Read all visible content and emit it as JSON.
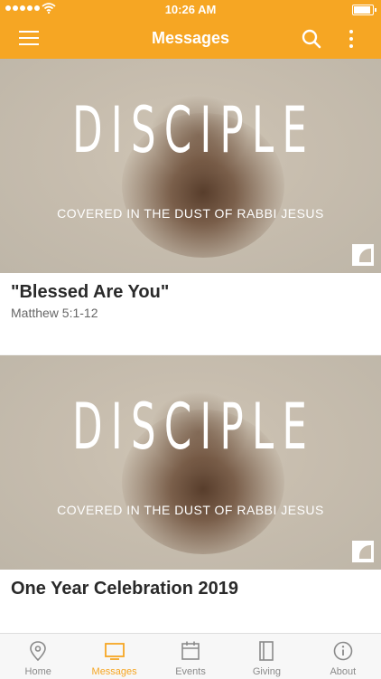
{
  "status_bar": {
    "time": "10:26 AM"
  },
  "app_bar": {
    "title": "Messages"
  },
  "series": {
    "title": "DISCIPLE",
    "subtitle": "COVERED IN THE DUST OF RABBI JESUS"
  },
  "messages": [
    {
      "title": "\"Blessed Are You\"",
      "reference": "Matthew 5:1-12"
    },
    {
      "title": "One Year Celebration 2019",
      "reference": ""
    }
  ],
  "tabs": [
    {
      "label": "Home",
      "icon": "location-pin-icon"
    },
    {
      "label": "Messages",
      "icon": "monitor-icon",
      "active": true
    },
    {
      "label": "Events",
      "icon": "calendar-icon"
    },
    {
      "label": "Giving",
      "icon": "book-icon"
    },
    {
      "label": "About",
      "icon": "info-icon"
    }
  ],
  "colors": {
    "accent": "#f6a623",
    "tab_inactive": "#8a8a8a"
  }
}
